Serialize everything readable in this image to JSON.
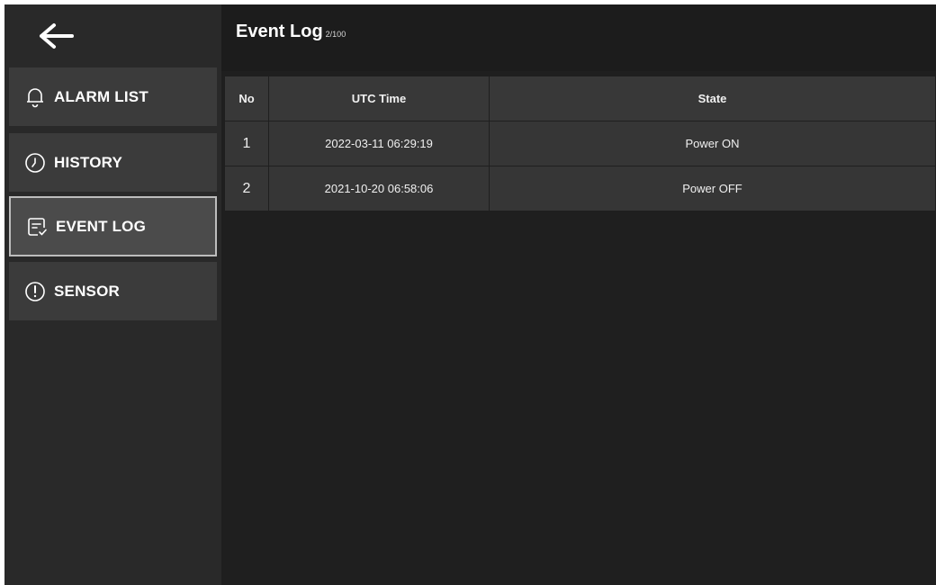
{
  "sidebar": {
    "items": [
      {
        "label": "ALARM LIST",
        "icon": "bell-icon"
      },
      {
        "label": "HISTORY",
        "icon": "clock-icon"
      },
      {
        "label": "EVENT LOG",
        "icon": "log-icon",
        "active": true
      },
      {
        "label": "SENSOR",
        "icon": "alert-icon"
      }
    ]
  },
  "header": {
    "title": "Event Log",
    "count": "2/100"
  },
  "table": {
    "columns": [
      "No",
      "UTC Time",
      "State"
    ],
    "rows": [
      {
        "no": "1",
        "time": "2022-03-11 06:29:19",
        "state": "Power ON"
      },
      {
        "no": "2",
        "time": "2021-10-20 06:58:06",
        "state": "Power OFF"
      }
    ]
  },
  "colors": {
    "sidebar_bg": "#292929",
    "nav_item_bg": "#3b3b3b",
    "nav_active_bg": "#4b4b4b",
    "nav_active_border": "#bdbdbd",
    "main_bg": "#1f1f1f",
    "cell_bg": "#363636",
    "text": "#ffffff"
  }
}
